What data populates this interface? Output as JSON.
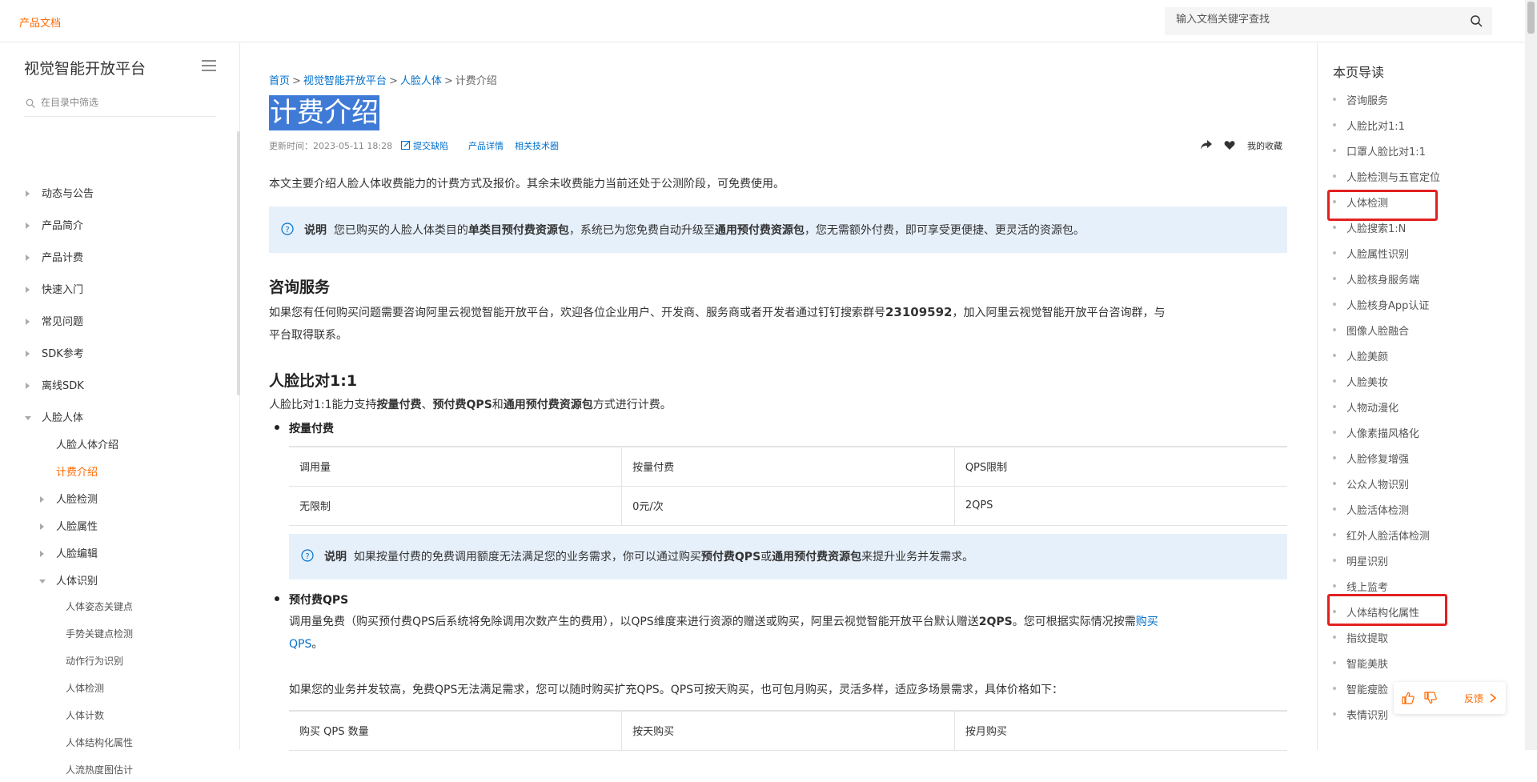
{
  "header": {
    "brand": "产品文档",
    "search_placeholder": "输入文档关键字查找"
  },
  "sidebar": {
    "title": "视觉智能开放平台",
    "filter_placeholder": "在目录中筛选",
    "items": [
      {
        "label": "动态与公告"
      },
      {
        "label": "产品简介"
      },
      {
        "label": "产品计费"
      },
      {
        "label": "快速入门"
      },
      {
        "label": "常见问题"
      },
      {
        "label": "SDK参考"
      },
      {
        "label": "离线SDK"
      },
      {
        "label": "人脸人体"
      },
      {
        "label": "人脸人体介绍"
      },
      {
        "label": "计费介绍"
      },
      {
        "label": "人脸检测"
      },
      {
        "label": "人脸属性"
      },
      {
        "label": "人脸编辑"
      },
      {
        "label": "人体识别"
      },
      {
        "label": "人体姿态关键点"
      },
      {
        "label": "手势关键点检测"
      },
      {
        "label": "动作行为识别"
      },
      {
        "label": "人体检测"
      },
      {
        "label": "人体计数"
      },
      {
        "label": "人体结构化属性"
      },
      {
        "label": "人流热度图估计"
      }
    ]
  },
  "main": {
    "breadcrumb": [
      "首页",
      "视觉智能开放平台",
      "人脸人体",
      "计费介绍"
    ],
    "title": "计费介绍",
    "updated": "更新时间：2023-05-11 18:28",
    "feedback_link": "提交缺陷",
    "detail_link": "产品详情",
    "forum_link": "相关技术圈",
    "favorite": "我的收藏",
    "intro": "本文主要介绍人脸人体收费能力的计费方式及报价。其余未收费能力当前还处于公测阶段，可免费使用。",
    "note1": {
      "label": "说明",
      "t1": "您已购买的人脸人体类目的",
      "b1": "单类目预付费资源包",
      "t2": "，系统已为您免费自动升级至",
      "b2": "通用预付费资源包",
      "t3": "，您无需额外付费，即可享受更便捷、更灵活的资源包。"
    },
    "sec_consult": "咨询服务",
    "consult_text_1": "如果您有任何购买问题需要咨询阿里云视觉智能开放平台，欢迎各位企业用户、开发商、服务商或者开发者通过钉钉搜索群号",
    "consult_group": "23109592",
    "consult_text_2": "，加入阿里云视觉智能开放平台咨询群，与",
    "consult_text_3": "平台取得联系。",
    "sec_compare": "人脸比对1:1",
    "compare_t1": "人脸比对1:1能力支持",
    "compare_b1": "按量付费",
    "compare_t2": "、",
    "compare_b2": "预付费QPS",
    "compare_t3": "和",
    "compare_b3": "通用预付费资源包",
    "compare_t4": "方式进行计费。",
    "bullet1": "按量付费",
    "table1": {
      "headers": [
        "调用量",
        "按量付费",
        "QPS限制"
      ],
      "rows": [
        [
          "无限制",
          "0元/次",
          "2QPS"
        ]
      ]
    },
    "note2": {
      "label": "说明",
      "t1": "如果按量付费的免费调用额度无法满足您的业务需求，你可以通过购买",
      "b1": "预付费QPS",
      "t2": "或",
      "b2": "通用预付费资源包",
      "t3": "来提升业务并发需求。"
    },
    "bullet2": "预付费QPS",
    "qps_t1": "调用量免费（购买预付费QPS后系统将免除调用次数产生的费用），以QPS维度来进行资源的赠送或购买，阿里云视觉智能开放平台默认赠送",
    "qps_b1": "2QPS",
    "qps_t2": "。您可根据实际情况按需",
    "qps_link": "购买",
    "qps_link2": "QPS",
    "qps_t3": "。",
    "qps_t4": "如果您的业务并发较高，免费QPS无法满足需求，您可以随时购买扩充QPS。QPS可按天购买，也可包月购买，灵活多样，适应多场景需求，具体价格如下：",
    "table2": {
      "headers": [
        "购买 QPS 数量",
        "按天购买",
        "按月购买"
      ]
    }
  },
  "toc": {
    "heading": "本页导读",
    "items": [
      "咨询服务",
      "人脸比对1:1",
      "口罩人脸比对1:1",
      "人脸检测与五官定位",
      "人体检测",
      "人脸搜索1:N",
      "人脸属性识别",
      "人脸核身服务端",
      "人脸核身App认证",
      "图像人脸融合",
      "人脸美颜",
      "人脸美妆",
      "人物动漫化",
      "人像素描风格化",
      "人脸修复增强",
      "公众人物识别",
      "人脸活体检测",
      "红外人脸活体检测",
      "明星识别",
      "线上监考",
      "人体结构化属性",
      "指纹提取",
      "智能美肤",
      "智能瘦脸",
      "表情识别"
    ]
  },
  "feedback_widget": {
    "label": "反馈"
  },
  "colors": {
    "accent": "#ff6a00",
    "link": "#0070cc",
    "highlight_box": "#e32020",
    "note_bg": "#e6f0fb"
  }
}
